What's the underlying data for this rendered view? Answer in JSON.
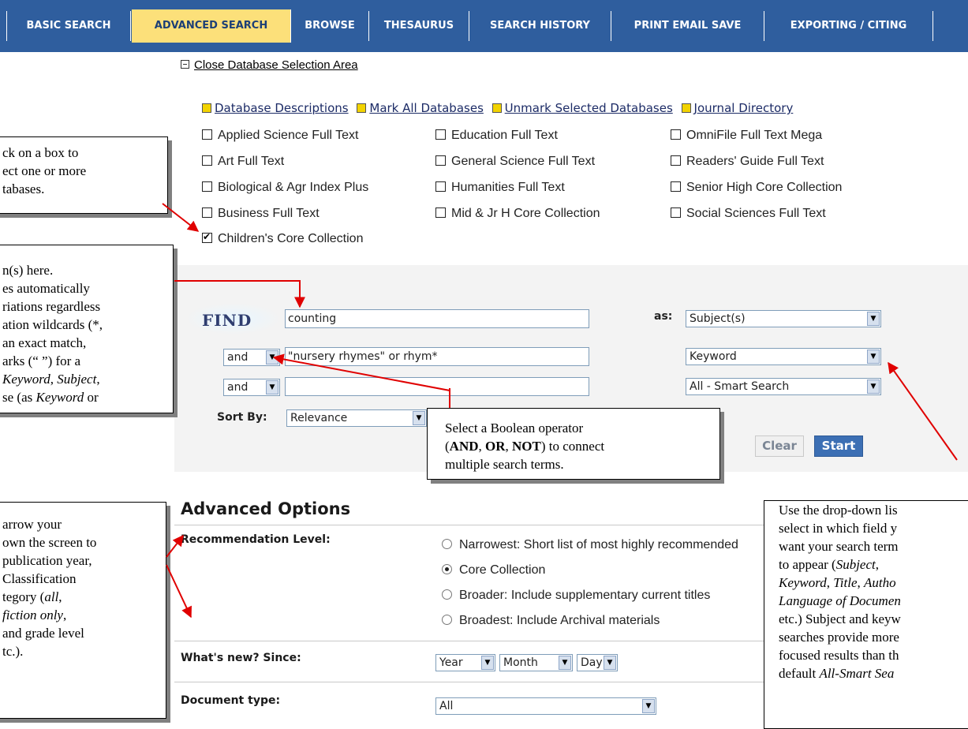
{
  "nav": {
    "tabs": [
      {
        "label": "BASIC SEARCH",
        "active": false
      },
      {
        "label": "ADVANCED SEARCH",
        "active": true
      },
      {
        "label": "BROWSE",
        "active": false
      },
      {
        "label": "THESAURUS",
        "active": false
      },
      {
        "label": "SEARCH HISTORY",
        "active": false
      },
      {
        "label": "PRINT EMAIL SAVE",
        "active": false
      },
      {
        "label": "EXPORTING / CITING",
        "active": false
      }
    ]
  },
  "database_area": {
    "close_link": "Close Database Selection Area",
    "links": [
      "Database Descriptions",
      "Mark All Databases",
      "Unmark Selected Databases",
      "Journal Directory"
    ],
    "databases": [
      {
        "label": "Applied Science Full Text",
        "checked": false
      },
      {
        "label": "Art Full Text",
        "checked": false
      },
      {
        "label": "Biological & Agr Index Plus",
        "checked": false
      },
      {
        "label": "Business Full Text",
        "checked": false
      },
      {
        "label": "Children's Core Collection",
        "checked": true
      },
      {
        "label": "Education Full Text",
        "checked": false
      },
      {
        "label": "General Science Full Text",
        "checked": false
      },
      {
        "label": "Humanities Full Text",
        "checked": false
      },
      {
        "label": "Mid & Jr H Core Collection",
        "checked": false
      },
      {
        "label": "OmniFile Full Text Mega",
        "checked": false
      },
      {
        "label": "Readers' Guide Full Text",
        "checked": false
      },
      {
        "label": "Senior High Core Collection",
        "checked": false
      },
      {
        "label": "Social Sciences Full Text",
        "checked": false
      }
    ]
  },
  "search_form": {
    "find_label": "FIND",
    "as_label": "as:",
    "rows": [
      {
        "operator": "",
        "term": "counting",
        "field": "Subject(s)"
      },
      {
        "operator": "and",
        "term": "\"nursery rhymes\" or rhym*",
        "field": "Keyword"
      },
      {
        "operator": "and",
        "term": "",
        "field": "All - Smart Search"
      }
    ],
    "sort_label": "Sort By:",
    "sort_value": "Relevance",
    "clear_label": "Clear",
    "start_label": "Start"
  },
  "advanced_options": {
    "title": "Advanced Options",
    "recommendation_label": "Recommendation Level:",
    "recommendation_options": [
      {
        "label": "Narrowest: Short list of most highly recommended",
        "selected": false
      },
      {
        "label": "Core Collection",
        "selected": true
      },
      {
        "label": "Broader: Include supplementary current titles",
        "selected": false
      },
      {
        "label": "Broadest: Include Archival materials",
        "selected": false
      }
    ],
    "whats_new_label": "What's new? Since:",
    "year": "Year",
    "month": "Month",
    "day": "Day",
    "doctype_label": "Document type:",
    "doctype_value": "All"
  },
  "callouts": {
    "databases": [
      "ck on a box to",
      "ect one or more",
      "tabases."
    ],
    "terms": [
      {
        "parts": [
          {
            "t": "n(s) here."
          }
        ]
      },
      {
        "parts": [
          {
            "t": "es automatically"
          }
        ]
      },
      {
        "parts": [
          {
            "t": "riations regardless"
          }
        ]
      },
      {
        "parts": [
          {
            "t": "ation wildcards (*,"
          }
        ]
      },
      {
        "parts": [
          {
            "t": "an exact match,"
          }
        ]
      },
      {
        "parts": [
          {
            "t": "arks (“ ”) for a"
          }
        ]
      },
      {
        "parts": [
          {
            "t": "Keyword",
            "i": true
          },
          {
            "t": ", "
          },
          {
            "t": "Subject",
            "i": true
          },
          {
            "t": ","
          }
        ]
      },
      {
        "parts": [
          {
            "t": "se (as "
          },
          {
            "t": "Keyword",
            "i": true
          },
          {
            "t": " or"
          }
        ]
      }
    ],
    "boolean": [
      {
        "parts": [
          {
            "t": "Select a Boolean operator"
          }
        ]
      },
      {
        "parts": [
          {
            "t": "("
          },
          {
            "t": "AND",
            "b": true
          },
          {
            "t": ", "
          },
          {
            "t": "OR",
            "b": true
          },
          {
            "t": ", "
          },
          {
            "t": "NOT",
            "b": true
          },
          {
            "t": ") to connect"
          }
        ]
      },
      {
        "parts": [
          {
            "t": "multiple search terms."
          }
        ]
      }
    ],
    "narrow": [
      {
        "parts": [
          {
            "t": "arrow your"
          }
        ]
      },
      {
        "parts": [
          {
            "t": "own the screen to"
          }
        ]
      },
      {
        "parts": [
          {
            "t": "publication year,"
          }
        ]
      },
      {
        "parts": [
          {
            "t": "Classification"
          }
        ]
      },
      {
        "parts": [
          {
            "t": "tegory ("
          },
          {
            "t": "all",
            "i": true
          },
          {
            "t": ","
          }
        ]
      },
      {
        "parts": [
          {
            "t": "fiction only",
            "i": true
          },
          {
            "t": ","
          }
        ]
      },
      {
        "parts": [
          {
            "t": " and grade level"
          }
        ]
      },
      {
        "parts": [
          {
            "t": "tc.)."
          }
        ]
      }
    ],
    "dropdown": [
      {
        "parts": [
          {
            "t": "Use the drop-down lis"
          }
        ]
      },
      {
        "parts": [
          {
            "t": "select in which field y"
          }
        ]
      },
      {
        "parts": [
          {
            "t": "want your search term"
          }
        ]
      },
      {
        "parts": [
          {
            "t": "to appear ("
          },
          {
            "t": "Subject",
            "i": true
          },
          {
            "t": ","
          }
        ]
      },
      {
        "parts": [
          {
            "t": "Keyword",
            "i": true
          },
          {
            "t": ", "
          },
          {
            "t": "Title",
            "i": true
          },
          {
            "t": ", "
          },
          {
            "t": "Autho",
            "i": true
          }
        ]
      },
      {
        "parts": [
          {
            "t": "Language of Documen",
            "i": true
          }
        ]
      },
      {
        "parts": [
          {
            "t": "etc.) Subject and keyw"
          }
        ]
      },
      {
        "parts": [
          {
            "t": "searches provide more"
          }
        ]
      },
      {
        "parts": [
          {
            "t": "focused results than th"
          }
        ]
      },
      {
        "parts": [
          {
            "t": "default "
          },
          {
            "t": "All-Smart Sea",
            "i": true
          }
        ]
      }
    ]
  },
  "colors": {
    "nav_bg": "#2f5e9e",
    "nav_active_bg": "#fce07a",
    "arrow": "#e00000",
    "start_button": "#3c6fb4"
  }
}
